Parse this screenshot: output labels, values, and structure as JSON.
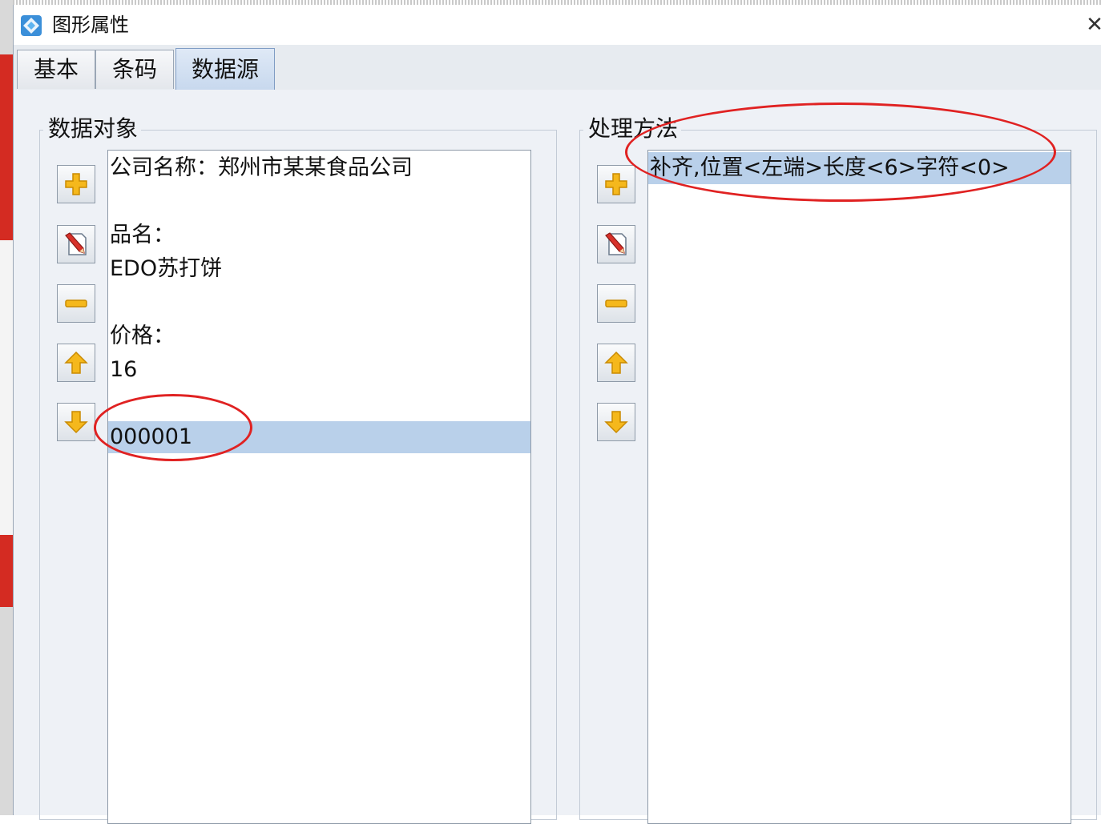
{
  "window": {
    "title": "图形属性",
    "close_glyph": "✕"
  },
  "tabs": [
    {
      "label": "基本",
      "active": false
    },
    {
      "label": "条码",
      "active": false
    },
    {
      "label": "数据源",
      "active": true
    }
  ],
  "data_objects": {
    "label": "数据对象",
    "items": [
      {
        "text": "公司名称：郑州市某某食品公司",
        "selected": false
      },
      {
        "text": "",
        "selected": false
      },
      {
        "text": "品名：",
        "selected": false
      },
      {
        "text": "EDO苏打饼",
        "selected": false
      },
      {
        "text": "",
        "selected": false
      },
      {
        "text": "价格：",
        "selected": false
      },
      {
        "text": "16",
        "selected": false
      },
      {
        "text": "",
        "selected": false
      },
      {
        "text": "000001",
        "selected": true
      }
    ],
    "buttons": [
      "add-icon",
      "edit-icon",
      "remove-icon",
      "move-up-icon",
      "move-down-icon"
    ]
  },
  "processing_methods": {
    "label": "处理方法",
    "items": [
      {
        "text": "补齐,位置<左端>长度<6>字符<0>",
        "selected": true
      }
    ],
    "buttons": [
      "add-icon",
      "edit-icon",
      "remove-icon",
      "move-up-icon",
      "move-down-icon"
    ]
  },
  "colors": {
    "selection": "#b9d0ea",
    "annotation_circle": "#e02222",
    "icon_yellow": "#f5b81c",
    "dialog_bg": "#eef1f6"
  }
}
